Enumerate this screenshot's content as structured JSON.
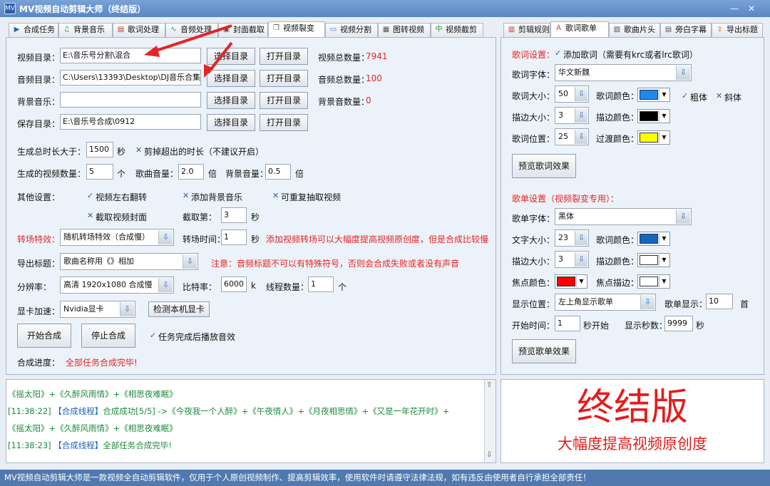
{
  "window": {
    "title": "MV视频自动剪辑大师（终结版）"
  },
  "tabs_left": [
    {
      "label": "合成任务",
      "icon": "play-icon"
    },
    {
      "label": "背景音乐",
      "icon": "music-icon"
    },
    {
      "label": "歌词处理",
      "icon": "lyrics-icon"
    },
    {
      "label": "音频处理",
      "icon": "audio-wave-icon"
    },
    {
      "label": "封面截取",
      "icon": "cover-icon"
    },
    {
      "label": "视频裂变",
      "icon": "copy-icon"
    },
    {
      "label": "视频分割",
      "icon": "video-split-icon"
    },
    {
      "label": "图转视频",
      "icon": "image-video-icon"
    },
    {
      "label": "视频截剪",
      "icon": "crop-icon"
    }
  ],
  "tabs_right": [
    {
      "label": "剪辑规则",
      "icon": "film-icon"
    },
    {
      "label": "歌词歌单",
      "icon": "font-a-icon"
    },
    {
      "label": "歌曲片头",
      "icon": "image-icon"
    },
    {
      "label": "旁白字幕",
      "icon": "doc-icon"
    },
    {
      "label": "导出标题",
      "icon": "export-icon"
    }
  ],
  "left": {
    "video_dir_label": "视频目录：",
    "video_dir": "E:\\音乐号分割\\混合",
    "audio_dir_label": "音频目录：",
    "audio_dir": "C:\\Users\\13393\\Desktop\\DJ音乐合集",
    "bgm_label": "背景音乐：",
    "bgm_dir": "",
    "save_dir_label": "保存目录：",
    "save_dir": "E:\\音乐号合成\\0912",
    "choose_btn": "选择目录",
    "open_btn": "打开目录",
    "video_total_label": "视频总数量：",
    "video_total": "7941",
    "audio_total_label": "音频总数量：",
    "audio_total": "100",
    "bgm_total_label": "背景音数量：",
    "bgm_total": "0",
    "gen_total_label": "生成总时长大于：",
    "gen_total": "1500",
    "sec": "秒",
    "cut_over": "剪掉超出的时长（不建议开启）",
    "gen_count_label": "生成的视频数量：",
    "gen_count": "5",
    "unit_ge": "个",
    "song_vol_label": "歌曲音量：",
    "song_vol": "2.0",
    "unit_bei": "倍",
    "bg_vol_label": "背景音量：",
    "bg_vol": "0.5",
    "other_label": "其他设置：",
    "opt_flip": "视频左右翻转",
    "opt_bgm": "添加背景音乐",
    "opt_repeat": "可重复抽取视频",
    "opt_cover": "截取视频封面",
    "cover_label": "截取第：",
    "cover_val": "3",
    "trans_label": "转场特效：",
    "trans_val": "随机转场特效（合成慢）",
    "trans_time_label": "转场时间：",
    "trans_time": "1",
    "trans_note": "添加视频转场可以大幅度提高视频原创度，但是合成比较慢",
    "title_label": "导出标题：",
    "title_val": "歌曲名称用《》相加",
    "title_note": "注意：音频标题不可以有特殊符号，否则会合成失败或者没有声音",
    "res_label": "分辨率：",
    "res_val": "高清 1920x1080 合成慢",
    "bitrate_label": "比特率：",
    "bitrate": "6000",
    "unit_k": "k",
    "threads_label": "线程数量：",
    "threads": "1",
    "gpu_label": "显卡加速：",
    "gpu_val": "Nvidia显卡",
    "detect_btn": "检测本机显卡",
    "start_btn": "开始合成",
    "stop_btn": "停止合成",
    "play_done": "任务完成后播放音效",
    "progress_label": "合成进度：",
    "progress_val": "全部任务合成完毕!"
  },
  "right": {
    "lyric_settings": "歌词设置：",
    "add_lyric": "添加歌词（需要有krc或者lrc歌词）",
    "lyric_font_label": "歌词字体：",
    "lyric_font": "华文新魏",
    "lyric_size_label": "歌词大小：",
    "lyric_size": "50",
    "lyric_color_label": "歌词颜色：",
    "lyric_color": "#1e88f0",
    "bold": "粗体",
    "italic": "斜体",
    "stroke_size_label": "描边大小：",
    "stroke_size": "3",
    "stroke_color_label": "描边颜色：",
    "stroke_color": "#000000",
    "lyric_pos_label": "歌词位置：",
    "lyric_pos": "25",
    "trans_color_label": "过渡颜色：",
    "trans_color": "#ffff00",
    "preview_lyric": "预览歌词效果",
    "playlist_settings": "歌单设置（视频裂变专用）：",
    "pl_font_label": "歌单字体：",
    "pl_font": "黑体",
    "text_size_label": "文字大小：",
    "text_size": "23",
    "pl_color_label": "歌词颜色：",
    "pl_color": "#1565c0",
    "pl_stroke_label": "描边大小：",
    "pl_stroke": "3",
    "pl_stroke_color_label": "描边颜色：",
    "pl_stroke_color": "#ffffff",
    "focus_color_label": "焦点颜色：",
    "focus_color": "#ff0000",
    "focus_stroke_label": "焦点描边：",
    "focus_stroke_color": "#ffffff",
    "display_pos_label": "显示位置：",
    "display_pos": "左上角显示歌单",
    "pl_show_label": "歌单显示：",
    "pl_show": "10",
    "unit_shou": "首",
    "start_time_label": "开始时间：",
    "start_time": "1",
    "start_suffix": "秒开始",
    "show_secs_label": "显示秒数：",
    "show_secs": "9999",
    "unit_miao": "秒",
    "preview_pl": "预览歌单效果"
  },
  "log": {
    "lines": [
      "《摇太阳》+《久醉风雨情》+《相思夜难眠》",
      "[11:38:22] 【合成线程】合成成功[5/5] ->《今夜我一个人醉》+《午夜情人》+《月夜相思情》+《又是一年花开时》+",
      "《摇太阳》+《久醉风雨情》+《相思夜难眠》",
      "[11:38:23] 【合成线程】全部任务合成完毕!"
    ]
  },
  "banner": {
    "title": "终结版",
    "subtitle": "大幅度提高视频原创度"
  },
  "status": "MV视频自动剪辑大师是一款视频全自动剪辑软件，仅用于个人原创视频制作、提高剪辑效率，使用软件时请遵守法律法规，如有违反由使用者自行承担全部责任！"
}
